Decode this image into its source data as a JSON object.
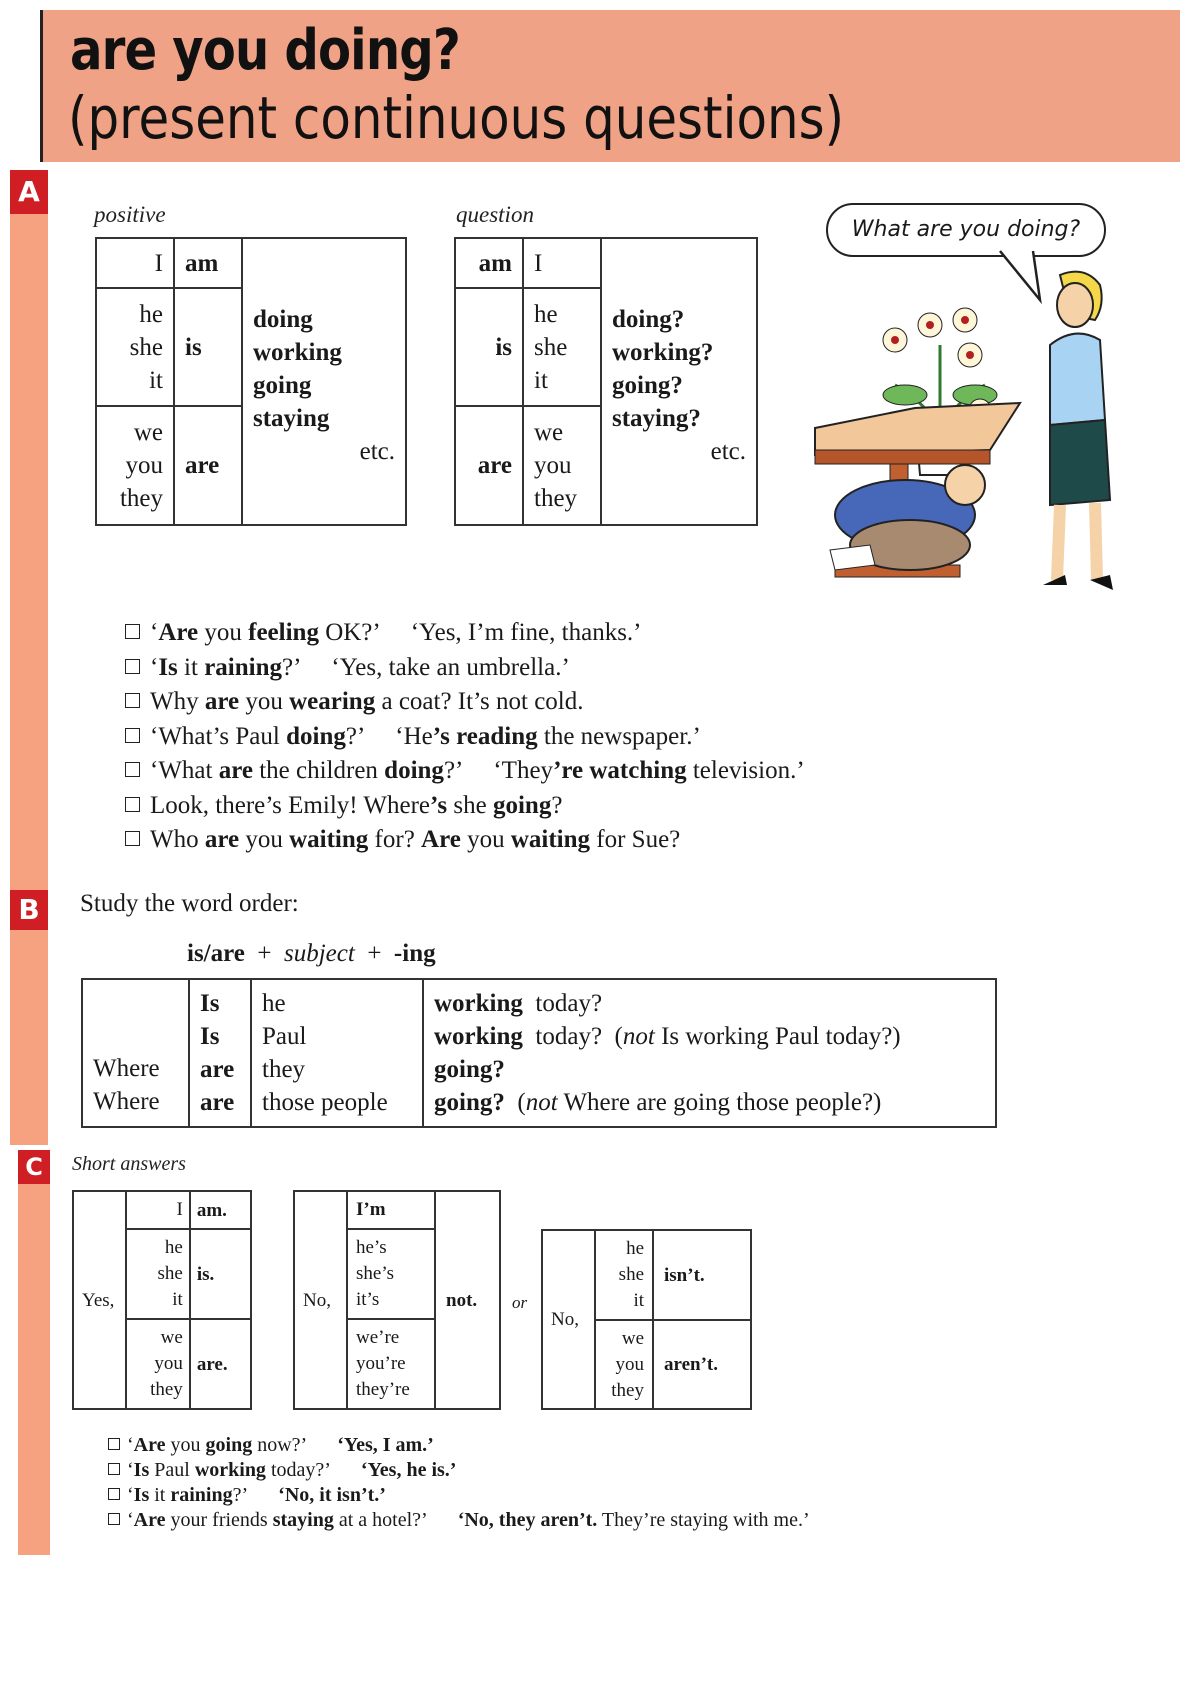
{
  "header": {
    "title_line1": "are you doing?",
    "title_line2": "(present continuous questions)",
    "colors": {
      "header_bg": "#f0a286",
      "strip": "#f6a17f",
      "section_label": "#cf1e24"
    }
  },
  "section_a": {
    "label": "A",
    "positive": {
      "caption": "positive",
      "subjects": [
        "I",
        "he\nshe\nit",
        "we\nyou\nthey"
      ],
      "verbs": [
        "am",
        "is",
        "are"
      ],
      "ing_forms": [
        "doing",
        "working",
        "going",
        "staying"
      ],
      "etc": "etc."
    },
    "question": {
      "caption": "question",
      "verbs": [
        "am",
        "is",
        "are"
      ],
      "subjects": [
        "I",
        "he\nshe\nit",
        "we\nyou\nthey"
      ],
      "ing_forms": [
        "doing?",
        "working?",
        "going?",
        "staying?"
      ],
      "etc": "etc."
    },
    "illustration": {
      "speech_bubble": "What are you doing?",
      "description": "woman asking man hiding under a table with flower vase"
    },
    "examples": [
      [
        {
          "t": "‘"
        },
        {
          "t": "Are",
          "b": true
        },
        {
          "t": " you "
        },
        {
          "t": "feeling",
          "b": true
        },
        {
          "t": " OK?’"
        },
        {
          "gap": true
        },
        {
          "t": "‘Yes, I’m fine, thanks.’"
        }
      ],
      [
        {
          "t": "‘"
        },
        {
          "t": "Is",
          "b": true
        },
        {
          "t": " it "
        },
        {
          "t": "raining",
          "b": true
        },
        {
          "t": "?’"
        },
        {
          "gap": true
        },
        {
          "t": "‘Yes, take an umbrella.’"
        }
      ],
      [
        {
          "t": "Why "
        },
        {
          "t": "are",
          "b": true
        },
        {
          "t": " you "
        },
        {
          "t": "wearing",
          "b": true
        },
        {
          "t": " a coat?  It’s not cold."
        }
      ],
      [
        {
          "t": "‘What’s Paul "
        },
        {
          "t": "doing",
          "b": true
        },
        {
          "t": "?’"
        },
        {
          "gap": true
        },
        {
          "t": "‘He"
        },
        {
          "t": "’s reading",
          "b": true
        },
        {
          "t": " the newspaper.’"
        }
      ],
      [
        {
          "t": "‘What "
        },
        {
          "t": "are",
          "b": true
        },
        {
          "t": " the children "
        },
        {
          "t": "doing",
          "b": true
        },
        {
          "t": "?’"
        },
        {
          "gap": true
        },
        {
          "t": "‘They"
        },
        {
          "t": "’re watching",
          "b": true
        },
        {
          "t": " television.’"
        }
      ],
      [
        {
          "t": "Look, there’s Emily!  Where"
        },
        {
          "t": "’s",
          "b": true
        },
        {
          "t": " she "
        },
        {
          "t": "going",
          "b": true
        },
        {
          "t": "?"
        }
      ],
      [
        {
          "t": "Who "
        },
        {
          "t": "are",
          "b": true
        },
        {
          "t": " you "
        },
        {
          "t": "waiting",
          "b": true
        },
        {
          "t": " for?  "
        },
        {
          "t": "Are",
          "b": true
        },
        {
          "t": " you "
        },
        {
          "t": "waiting",
          "b": true
        },
        {
          "t": " for Sue?"
        }
      ]
    ]
  },
  "section_b": {
    "label": "B",
    "intro": "Study the word order:",
    "formula": {
      "part1": "is/are",
      "plus": "+",
      "part2": "subject",
      "part3": "-ing"
    },
    "rows": [
      {
        "wh": "",
        "verb": "Is",
        "subject": "he",
        "ing": "working",
        "rest": "today?",
        "note_not": "",
        "note": ""
      },
      {
        "wh": "",
        "verb": "Is",
        "subject": "Paul",
        "ing": "working",
        "rest": "today?",
        "note_not": "not",
        "note": "Is working Paul today?)"
      },
      {
        "wh": "Where",
        "verb": "are",
        "subject": "they",
        "ing": "going?",
        "rest": "",
        "note_not": "",
        "note": ""
      },
      {
        "wh": "Where",
        "verb": "are",
        "subject": "those people",
        "ing": "going?",
        "rest": "",
        "note_not": "not",
        "note": "Where are going those people?)"
      }
    ]
  },
  "section_c": {
    "label": "C",
    "caption": "Short answers",
    "yes_table": {
      "lead": "Yes,",
      "subjects": [
        "I",
        "he\nshe\nit",
        "we\nyou\nthey"
      ],
      "verbs": [
        "am.",
        "is.",
        "are."
      ]
    },
    "no_table": {
      "lead": "No,",
      "subjects": [
        "I’m",
        "he’s\nshe’s\nit’s",
        "we’re\nyou’re\nthey’re"
      ],
      "tail": "not."
    },
    "or": "or",
    "no_table2": {
      "lead": "No,",
      "subjects": [
        "he\nshe\nit",
        "we\nyou\nthey"
      ],
      "verbs": [
        "isn’t.",
        "aren’t."
      ]
    },
    "examples": [
      [
        {
          "t": "‘"
        },
        {
          "t": "Are",
          "b": true
        },
        {
          "t": " you "
        },
        {
          "t": "going",
          "b": true
        },
        {
          "t": " now?’"
        },
        {
          "gap": true
        },
        {
          "t": "‘Yes, I am.’",
          "b": true
        }
      ],
      [
        {
          "t": "‘"
        },
        {
          "t": "Is",
          "b": true
        },
        {
          "t": " Paul "
        },
        {
          "t": "working",
          "b": true
        },
        {
          "t": " today?’"
        },
        {
          "gap": true
        },
        {
          "t": "‘Yes, he is.’",
          "b": true
        }
      ],
      [
        {
          "t": "‘"
        },
        {
          "t": "Is",
          "b": true
        },
        {
          "t": " it "
        },
        {
          "t": "raining",
          "b": true
        },
        {
          "t": "?’"
        },
        {
          "gap": true
        },
        {
          "t": "‘No, it isn’t.’",
          "b": true
        }
      ],
      [
        {
          "t": "‘"
        },
        {
          "t": "Are",
          "b": true
        },
        {
          "t": " your friends "
        },
        {
          "t": "staying",
          "b": true
        },
        {
          "t": " at a hotel?’"
        },
        {
          "gap": true
        },
        {
          "t": "‘No, they aren’t.",
          "b": true
        },
        {
          "t": " They’re staying with me.’"
        }
      ]
    ]
  }
}
